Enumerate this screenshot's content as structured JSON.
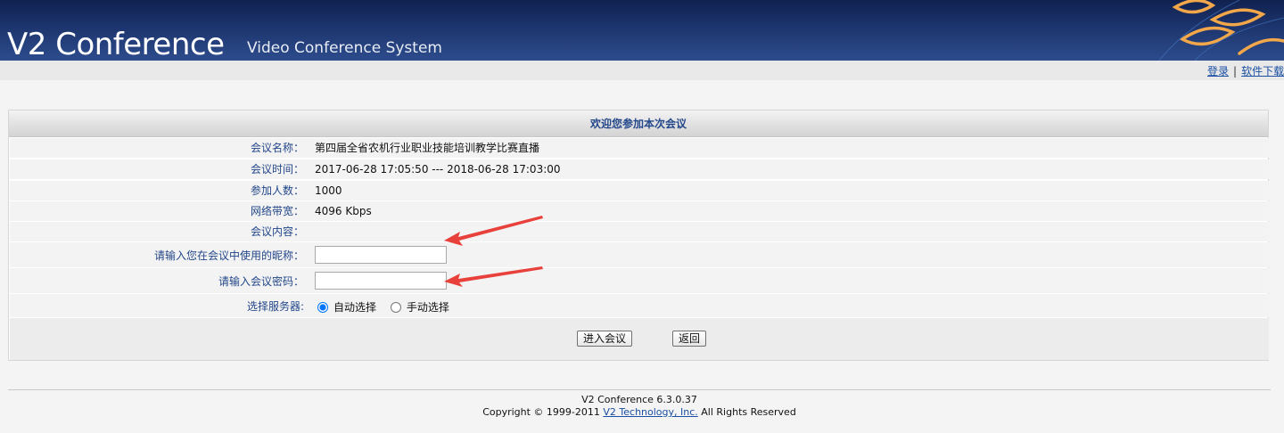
{
  "header": {
    "app_title": "V2 Conference",
    "app_subtitle": "Video Conference System"
  },
  "top_links": {
    "login": "登录",
    "separator": "|",
    "download": "软件下载"
  },
  "panel": {
    "title": "欢迎您参加本次会议",
    "rows": [
      {
        "label": "会议名称：",
        "value": "第四届全省农机行业职业技能培训教学比赛直播"
      },
      {
        "label": "会议时间：",
        "value": "2017-06-28 17:05:50 --- 2018-06-28 17:03:00"
      },
      {
        "label": "参加人数：",
        "value": "1000"
      },
      {
        "label": "网络带宽：",
        "value": "4096 Kbps"
      },
      {
        "label": "会议内容：",
        "value": ""
      }
    ],
    "nickname": {
      "label": "请输入您在会议中使用的昵称：",
      "value": ""
    },
    "password": {
      "label": "请输入会议密码：",
      "value": ""
    },
    "server": {
      "label": "选择服务器:",
      "options": [
        "自动选择",
        "手动选择"
      ],
      "selected": "自动选择"
    },
    "buttons": {
      "enter": "进入会议",
      "back": "返回"
    }
  },
  "footer": {
    "version": "V2 Conference 6.3.0.37",
    "copyright_prefix": "Copyright © 1999-2011 ",
    "company_link": "V2 Technology, Inc.",
    "copyright_suffix": " All Rights Reserved"
  },
  "colors": {
    "header_bg": "#1d356e",
    "label_text": "#23478a",
    "link": "#1a4fa3",
    "annotation_arrow": "#e8403a"
  }
}
